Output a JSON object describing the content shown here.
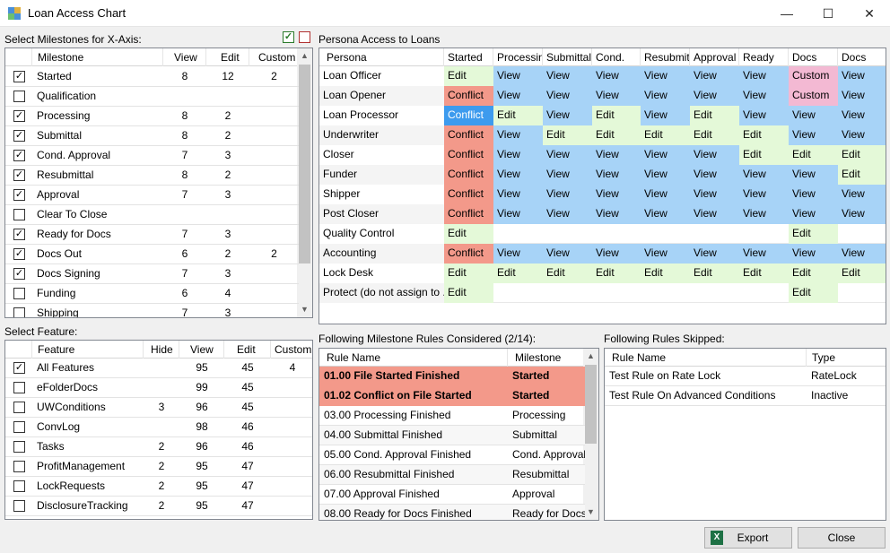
{
  "window": {
    "title": "Loan Access Chart",
    "minimize": "—",
    "maximize": "☐",
    "close": "✕"
  },
  "milestones": {
    "label": "Select Milestones for X-Axis:",
    "headers": [
      "Milestone",
      "View",
      "Edit",
      "Custom"
    ],
    "rows": [
      {
        "checked": true,
        "name": "Started",
        "view": "8",
        "edit": "12",
        "custom": "2"
      },
      {
        "checked": false,
        "name": "Qualification",
        "view": "",
        "edit": "",
        "custom": ""
      },
      {
        "checked": true,
        "name": "Processing",
        "view": "8",
        "edit": "2",
        "custom": ""
      },
      {
        "checked": true,
        "name": "Submittal",
        "view": "8",
        "edit": "2",
        "custom": ""
      },
      {
        "checked": true,
        "name": "Cond. Approval",
        "view": "7",
        "edit": "3",
        "custom": ""
      },
      {
        "checked": true,
        "name": "Resubmittal",
        "view": "8",
        "edit": "2",
        "custom": ""
      },
      {
        "checked": true,
        "name": "Approval",
        "view": "7",
        "edit": "3",
        "custom": ""
      },
      {
        "checked": false,
        "name": "Clear To Close",
        "view": "",
        "edit": "",
        "custom": ""
      },
      {
        "checked": true,
        "name": "Ready for Docs",
        "view": "7",
        "edit": "3",
        "custom": ""
      },
      {
        "checked": true,
        "name": "Docs Out",
        "view": "6",
        "edit": "2",
        "custom": "2"
      },
      {
        "checked": true,
        "name": "Docs Signing",
        "view": "7",
        "edit": "3",
        "custom": ""
      },
      {
        "checked": false,
        "name": "Funding",
        "view": "6",
        "edit": "4",
        "custom": ""
      },
      {
        "checked": false,
        "name": "Shipping",
        "view": "7",
        "edit": "3",
        "custom": ""
      }
    ]
  },
  "features": {
    "label": "Select Feature:",
    "headers": [
      "Feature",
      "Hide",
      "View",
      "Edit",
      "Custom"
    ],
    "rows": [
      {
        "checked": true,
        "name": "All Features",
        "hide": "",
        "view": "95",
        "edit": "45",
        "custom": "4"
      },
      {
        "checked": false,
        "name": "eFolderDocs",
        "hide": "",
        "view": "99",
        "edit": "45",
        "custom": ""
      },
      {
        "checked": false,
        "name": "UWConditions",
        "hide": "3",
        "view": "96",
        "edit": "45",
        "custom": ""
      },
      {
        "checked": false,
        "name": "ConvLog",
        "hide": "",
        "view": "98",
        "edit": "46",
        "custom": ""
      },
      {
        "checked": false,
        "name": "Tasks",
        "hide": "2",
        "view": "96",
        "edit": "46",
        "custom": ""
      },
      {
        "checked": false,
        "name": "ProfitManagement",
        "hide": "2",
        "view": "95",
        "edit": "47",
        "custom": ""
      },
      {
        "checked": false,
        "name": "LockRequests",
        "hide": "2",
        "view": "95",
        "edit": "47",
        "custom": ""
      },
      {
        "checked": false,
        "name": "DisclosureTracking",
        "hide": "2",
        "view": "95",
        "edit": "47",
        "custom": ""
      }
    ]
  },
  "access": {
    "label": "Persona Access to Loans",
    "headers": [
      "Persona",
      "Started",
      "Processin",
      "Submittal",
      "Cond.",
      "Resubmitt",
      "Approval",
      "Ready",
      "Docs",
      "Docs"
    ],
    "rows": [
      {
        "persona": "Loan Officer",
        "cells": [
          "Edit",
          "View",
          "View",
          "View",
          "View",
          "View",
          "View",
          "Custom",
          "View"
        ]
      },
      {
        "persona": "Loan Opener",
        "cells": [
          "Conflict",
          "View",
          "View",
          "View",
          "View",
          "View",
          "View",
          "Custom",
          "View"
        ]
      },
      {
        "persona": "Loan Processor",
        "cells": [
          "Conflict",
          "Edit",
          "View",
          "Edit",
          "View",
          "Edit",
          "View",
          "View",
          "View"
        ]
      },
      {
        "persona": "Underwriter",
        "cells": [
          "Conflict",
          "View",
          "Edit",
          "Edit",
          "Edit",
          "Edit",
          "Edit",
          "View",
          "View"
        ]
      },
      {
        "persona": "Closer",
        "cells": [
          "Conflict",
          "View",
          "View",
          "View",
          "View",
          "View",
          "Edit",
          "Edit",
          "Edit"
        ]
      },
      {
        "persona": "Funder",
        "cells": [
          "Conflict",
          "View",
          "View",
          "View",
          "View",
          "View",
          "View",
          "View",
          "Edit"
        ]
      },
      {
        "persona": "Shipper",
        "cells": [
          "Conflict",
          "View",
          "View",
          "View",
          "View",
          "View",
          "View",
          "View",
          "View"
        ]
      },
      {
        "persona": "Post Closer",
        "cells": [
          "Conflict",
          "View",
          "View",
          "View",
          "View",
          "View",
          "View",
          "View",
          "View"
        ]
      },
      {
        "persona": "Quality Control",
        "cells": [
          "Edit",
          "",
          "",
          "",
          "",
          "",
          "",
          "Edit",
          ""
        ]
      },
      {
        "persona": "Accounting",
        "cells": [
          "Conflict",
          "View",
          "View",
          "View",
          "View",
          "View",
          "View",
          "View",
          "View"
        ]
      },
      {
        "persona": "Lock Desk",
        "cells": [
          "Edit",
          "Edit",
          "Edit",
          "Edit",
          "Edit",
          "Edit",
          "Edit",
          "Edit",
          "Edit"
        ]
      },
      {
        "persona": "Protect (do not assign to ...",
        "cells": [
          "Edit",
          "",
          "",
          "",
          "",
          "",
          "",
          "Edit",
          ""
        ]
      }
    ],
    "colors": {
      "Edit": "#e4f9d8",
      "View": "#a7d3f7",
      "Conflict": "#f3998a",
      "Custom": "#f3b9d3"
    }
  },
  "rules_considered": {
    "label": "Following Milestone Rules Considered (2/14):",
    "headers": [
      "Rule Name",
      "Milestone"
    ],
    "rows": [
      {
        "name": "01.00 File Started Finished",
        "milestone": "Started",
        "hl": true
      },
      {
        "name": "01.02 Conflict on File Started",
        "milestone": "Started",
        "hl": true
      },
      {
        "name": "03.00 Processing Finished",
        "milestone": "Processing",
        "hl": false
      },
      {
        "name": "04.00 Submittal Finished",
        "milestone": "Submittal",
        "hl": false
      },
      {
        "name": "05.00 Cond. Approval Finished",
        "milestone": "Cond. Approval",
        "hl": false
      },
      {
        "name": "06.00 Resubmittal Finished",
        "milestone": "Resubmittal",
        "hl": false
      },
      {
        "name": "07.00 Approval Finished",
        "milestone": "Approval",
        "hl": false
      },
      {
        "name": "08.00 Ready for Docs Finished",
        "milestone": "Ready for Docs",
        "hl": false
      }
    ]
  },
  "rules_skipped": {
    "label": "Following Rules Skipped:",
    "headers": [
      "Rule Name",
      "Type"
    ],
    "rows": [
      {
        "name": "Test Rule on Rate Lock",
        "type": "RateLock"
      },
      {
        "name": "Test Rule On Advanced Conditions",
        "type": "Inactive"
      }
    ]
  },
  "buttons": {
    "export": "Export",
    "close": "Close"
  }
}
